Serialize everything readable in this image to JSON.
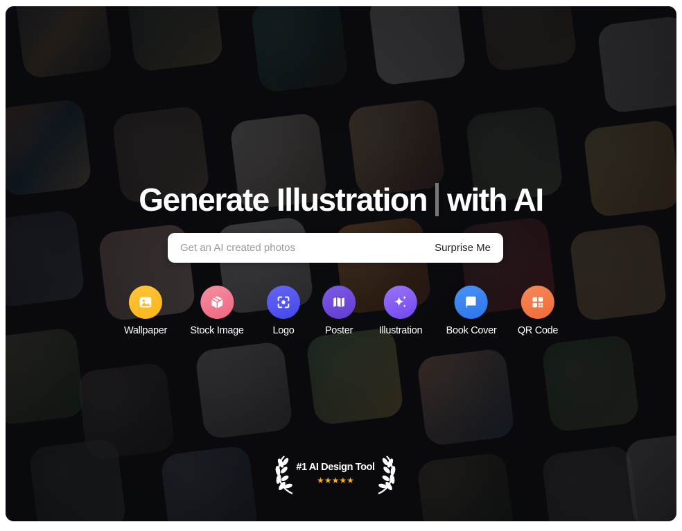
{
  "hero": {
    "headline_left": "Generate Illustration",
    "headline_right": "with AI"
  },
  "search": {
    "placeholder": "Get an AI created photos",
    "value": "",
    "surprise_label": "Surprise Me"
  },
  "categories": [
    {
      "label": "Wallpaper",
      "icon": "image-icon",
      "color_from": "#ffb81c",
      "color_to": "#ffc53a"
    },
    {
      "label": "Stock Image",
      "icon": "cube-icon",
      "color_from": "#f26f87",
      "color_to": "#f590a0"
    },
    {
      "label": "Logo",
      "icon": "focus-icon",
      "color_from": "#4f52f0",
      "color_to": "#6567f6"
    },
    {
      "label": "Poster",
      "icon": "map-icon",
      "color_from": "#6a46d8",
      "color_to": "#7e5be6"
    },
    {
      "label": "Illustration",
      "icon": "sparkles-icon",
      "color_from": "#7d53f2",
      "color_to": "#9670f8"
    },
    {
      "label": "Book Cover",
      "icon": "book-icon",
      "color_from": "#2f7ef0",
      "color_to": "#4a93f6"
    },
    {
      "label": "QR Code",
      "icon": "qr-icon",
      "color_from": "#f2733f",
      "color_to": "#f58a5a"
    }
  ],
  "award": {
    "title": "#1 AI Design Tool",
    "stars": "★★★★★",
    "star_color": "#f5b21a"
  }
}
